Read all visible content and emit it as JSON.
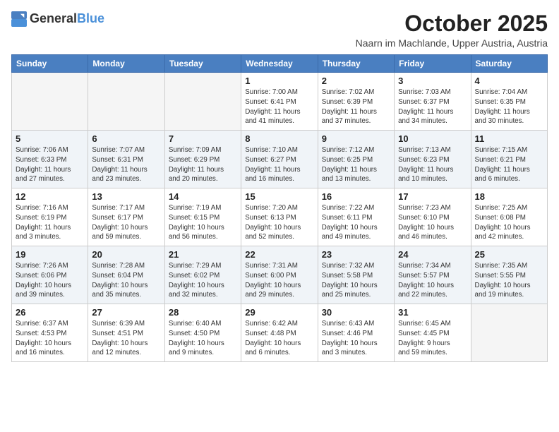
{
  "header": {
    "logo_general": "General",
    "logo_blue": "Blue",
    "month": "October 2025",
    "location": "Naarn im Machlande, Upper Austria, Austria"
  },
  "weekdays": [
    "Sunday",
    "Monday",
    "Tuesday",
    "Wednesday",
    "Thursday",
    "Friday",
    "Saturday"
  ],
  "weeks": [
    [
      {
        "day": "",
        "info": ""
      },
      {
        "day": "",
        "info": ""
      },
      {
        "day": "",
        "info": ""
      },
      {
        "day": "1",
        "info": "Sunrise: 7:00 AM\nSunset: 6:41 PM\nDaylight: 11 hours\nand 41 minutes."
      },
      {
        "day": "2",
        "info": "Sunrise: 7:02 AM\nSunset: 6:39 PM\nDaylight: 11 hours\nand 37 minutes."
      },
      {
        "day": "3",
        "info": "Sunrise: 7:03 AM\nSunset: 6:37 PM\nDaylight: 11 hours\nand 34 minutes."
      },
      {
        "day": "4",
        "info": "Sunrise: 7:04 AM\nSunset: 6:35 PM\nDaylight: 11 hours\nand 30 minutes."
      }
    ],
    [
      {
        "day": "5",
        "info": "Sunrise: 7:06 AM\nSunset: 6:33 PM\nDaylight: 11 hours\nand 27 minutes."
      },
      {
        "day": "6",
        "info": "Sunrise: 7:07 AM\nSunset: 6:31 PM\nDaylight: 11 hours\nand 23 minutes."
      },
      {
        "day": "7",
        "info": "Sunrise: 7:09 AM\nSunset: 6:29 PM\nDaylight: 11 hours\nand 20 minutes."
      },
      {
        "day": "8",
        "info": "Sunrise: 7:10 AM\nSunset: 6:27 PM\nDaylight: 11 hours\nand 16 minutes."
      },
      {
        "day": "9",
        "info": "Sunrise: 7:12 AM\nSunset: 6:25 PM\nDaylight: 11 hours\nand 13 minutes."
      },
      {
        "day": "10",
        "info": "Sunrise: 7:13 AM\nSunset: 6:23 PM\nDaylight: 11 hours\nand 10 minutes."
      },
      {
        "day": "11",
        "info": "Sunrise: 7:15 AM\nSunset: 6:21 PM\nDaylight: 11 hours\nand 6 minutes."
      }
    ],
    [
      {
        "day": "12",
        "info": "Sunrise: 7:16 AM\nSunset: 6:19 PM\nDaylight: 11 hours\nand 3 minutes."
      },
      {
        "day": "13",
        "info": "Sunrise: 7:17 AM\nSunset: 6:17 PM\nDaylight: 10 hours\nand 59 minutes."
      },
      {
        "day": "14",
        "info": "Sunrise: 7:19 AM\nSunset: 6:15 PM\nDaylight: 10 hours\nand 56 minutes."
      },
      {
        "day": "15",
        "info": "Sunrise: 7:20 AM\nSunset: 6:13 PM\nDaylight: 10 hours\nand 52 minutes."
      },
      {
        "day": "16",
        "info": "Sunrise: 7:22 AM\nSunset: 6:11 PM\nDaylight: 10 hours\nand 49 minutes."
      },
      {
        "day": "17",
        "info": "Sunrise: 7:23 AM\nSunset: 6:10 PM\nDaylight: 10 hours\nand 46 minutes."
      },
      {
        "day": "18",
        "info": "Sunrise: 7:25 AM\nSunset: 6:08 PM\nDaylight: 10 hours\nand 42 minutes."
      }
    ],
    [
      {
        "day": "19",
        "info": "Sunrise: 7:26 AM\nSunset: 6:06 PM\nDaylight: 10 hours\nand 39 minutes."
      },
      {
        "day": "20",
        "info": "Sunrise: 7:28 AM\nSunset: 6:04 PM\nDaylight: 10 hours\nand 35 minutes."
      },
      {
        "day": "21",
        "info": "Sunrise: 7:29 AM\nSunset: 6:02 PM\nDaylight: 10 hours\nand 32 minutes."
      },
      {
        "day": "22",
        "info": "Sunrise: 7:31 AM\nSunset: 6:00 PM\nDaylight: 10 hours\nand 29 minutes."
      },
      {
        "day": "23",
        "info": "Sunrise: 7:32 AM\nSunset: 5:58 PM\nDaylight: 10 hours\nand 25 minutes."
      },
      {
        "day": "24",
        "info": "Sunrise: 7:34 AM\nSunset: 5:57 PM\nDaylight: 10 hours\nand 22 minutes."
      },
      {
        "day": "25",
        "info": "Sunrise: 7:35 AM\nSunset: 5:55 PM\nDaylight: 10 hours\nand 19 minutes."
      }
    ],
    [
      {
        "day": "26",
        "info": "Sunrise: 6:37 AM\nSunset: 4:53 PM\nDaylight: 10 hours\nand 16 minutes."
      },
      {
        "day": "27",
        "info": "Sunrise: 6:39 AM\nSunset: 4:51 PM\nDaylight: 10 hours\nand 12 minutes."
      },
      {
        "day": "28",
        "info": "Sunrise: 6:40 AM\nSunset: 4:50 PM\nDaylight: 10 hours\nand 9 minutes."
      },
      {
        "day": "29",
        "info": "Sunrise: 6:42 AM\nSunset: 4:48 PM\nDaylight: 10 hours\nand 6 minutes."
      },
      {
        "day": "30",
        "info": "Sunrise: 6:43 AM\nSunset: 4:46 PM\nDaylight: 10 hours\nand 3 minutes."
      },
      {
        "day": "31",
        "info": "Sunrise: 6:45 AM\nSunset: 4:45 PM\nDaylight: 9 hours\nand 59 minutes."
      },
      {
        "day": "",
        "info": ""
      }
    ]
  ]
}
